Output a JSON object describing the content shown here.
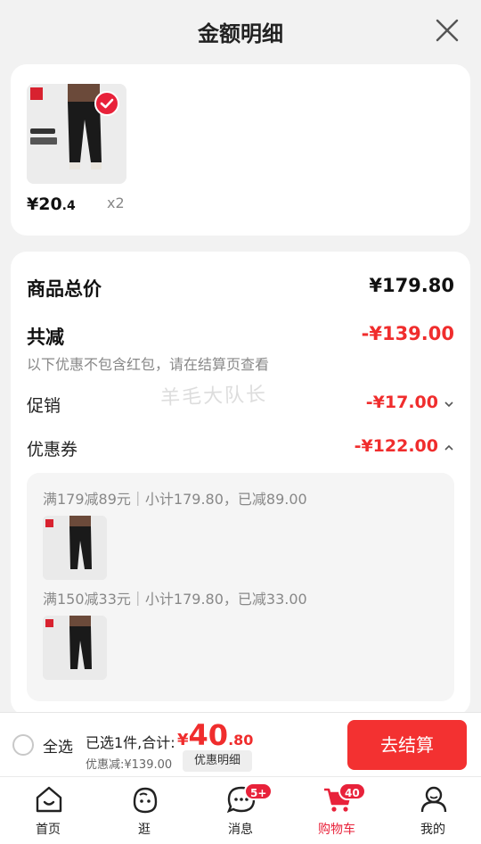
{
  "header": {
    "title": "金额明细"
  },
  "product": {
    "price_main": "¥20",
    "price_small": ".4",
    "quantity": "x2",
    "selected": true
  },
  "summary": {
    "total_label": "商品总价",
    "total_value": "¥179.80",
    "reduce_label": "共减",
    "reduce_value": "-¥139.00",
    "reduce_note": "以下优惠不包含红包，请在结算页查看",
    "promo_label": "促销",
    "promo_value": "-¥17.00",
    "coupon_label": "优惠券",
    "coupon_value": "-¥122.00",
    "coupons": [
      {
        "text": "满179减89元｜小计179.80，已减89.00"
      },
      {
        "text": "满150减33元｜小计179.80，已减33.00"
      }
    ]
  },
  "watermark": "羊毛大队长",
  "bottom": {
    "select_all": "全选",
    "selected_text": "已选1件,合计:",
    "total_yen": "¥",
    "total_int": "40",
    "total_dec": ".80",
    "discount_text": "优惠减:¥139.00",
    "detail_button": "优惠明细",
    "checkout_button": "去结算"
  },
  "tabs": [
    {
      "label": "首页",
      "icon": "home-icon"
    },
    {
      "label": "逛",
      "icon": "face-icon"
    },
    {
      "label": "消息",
      "icon": "chat-icon",
      "badge": "5+"
    },
    {
      "label": "购物车",
      "icon": "cart-icon",
      "badge": "40",
      "active": true
    },
    {
      "label": "我的",
      "icon": "user-icon"
    }
  ],
  "colors": {
    "accent": "#f02d2d",
    "brand": "#e8223a"
  }
}
